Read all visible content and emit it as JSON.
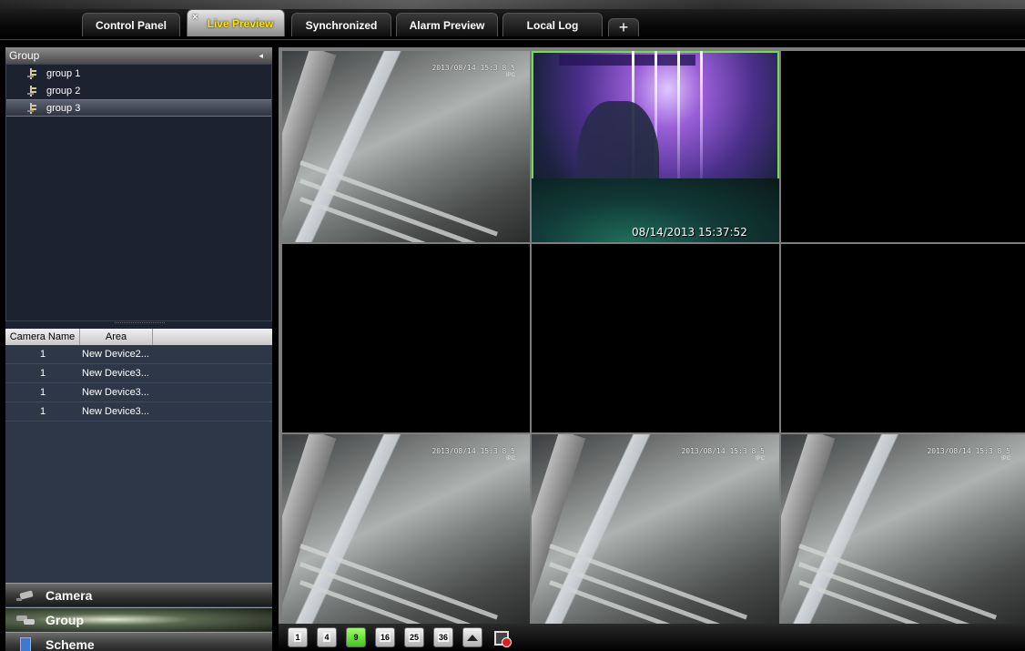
{
  "tabs": [
    {
      "label": "Control Panel",
      "active": false
    },
    {
      "label": "Live Preview",
      "active": true
    },
    {
      "label": "Synchronized",
      "active": false
    },
    {
      "label": "Alarm Preview",
      "active": false
    },
    {
      "label": "Local Log",
      "active": false
    }
  ],
  "tab_close_glyph": "×",
  "tab_add_glyph": "+",
  "group_panel": {
    "title": "Group",
    "collapse_glyph": "◂",
    "items": [
      {
        "label": "group 1",
        "selected": false
      },
      {
        "label": "group 2",
        "selected": false
      },
      {
        "label": "group 3",
        "selected": true
      }
    ]
  },
  "camera_table": {
    "headers": [
      "Camera Name",
      "Area"
    ],
    "rows": [
      {
        "name": "1",
        "area": "New Device2..."
      },
      {
        "name": "1",
        "area": "New Device3..."
      },
      {
        "name": "1",
        "area": "New Device3..."
      },
      {
        "name": "1",
        "area": "New Device3..."
      }
    ]
  },
  "nav": [
    {
      "label": "Camera",
      "icon": "camera-icon",
      "active": false
    },
    {
      "label": "Group",
      "icon": "group-icon",
      "active": true
    },
    {
      "label": "Scheme",
      "icon": "scheme-icon",
      "active": false
    }
  ],
  "video_grid": {
    "layout": "3x3",
    "selected_cell": 2,
    "cells": [
      {
        "feed": "corridor",
        "timestamp": "2013/08/14 15:3 8 5",
        "sub": "IPC"
      },
      {
        "feed": "forest",
        "timestamp": "08/14/2013 15:37:52",
        "sub": ""
      },
      {
        "feed": "empty",
        "timestamp": "",
        "sub": ""
      },
      {
        "feed": "empty",
        "timestamp": "",
        "sub": ""
      },
      {
        "feed": "empty",
        "timestamp": "",
        "sub": ""
      },
      {
        "feed": "empty",
        "timestamp": "",
        "sub": ""
      },
      {
        "feed": "corridor",
        "timestamp": "2013/08/14 15:3 8 5",
        "sub": "IPC"
      },
      {
        "feed": "corridor",
        "timestamp": "2013/08/14 15:3 8 5",
        "sub": "IPC"
      },
      {
        "feed": "corridor",
        "timestamp": "2013/08/14 15:3 8 5",
        "sub": "IPC"
      }
    ]
  },
  "toolbar": {
    "layout_buttons": [
      {
        "label": "1",
        "active": false
      },
      {
        "label": "4",
        "active": false
      },
      {
        "label": "9",
        "active": true
      },
      {
        "label": "16",
        "active": false
      },
      {
        "label": "25",
        "active": false
      },
      {
        "label": "36",
        "active": false
      }
    ],
    "extra_buttons": [
      "eject-icon",
      "disable-alarm-icon"
    ]
  },
  "colors": {
    "active_tab_text": "#ffe400",
    "selected_cell_border": "#6ee04a",
    "active_layout_button": "#3fc71c",
    "panel_bg": "#2d3748"
  }
}
